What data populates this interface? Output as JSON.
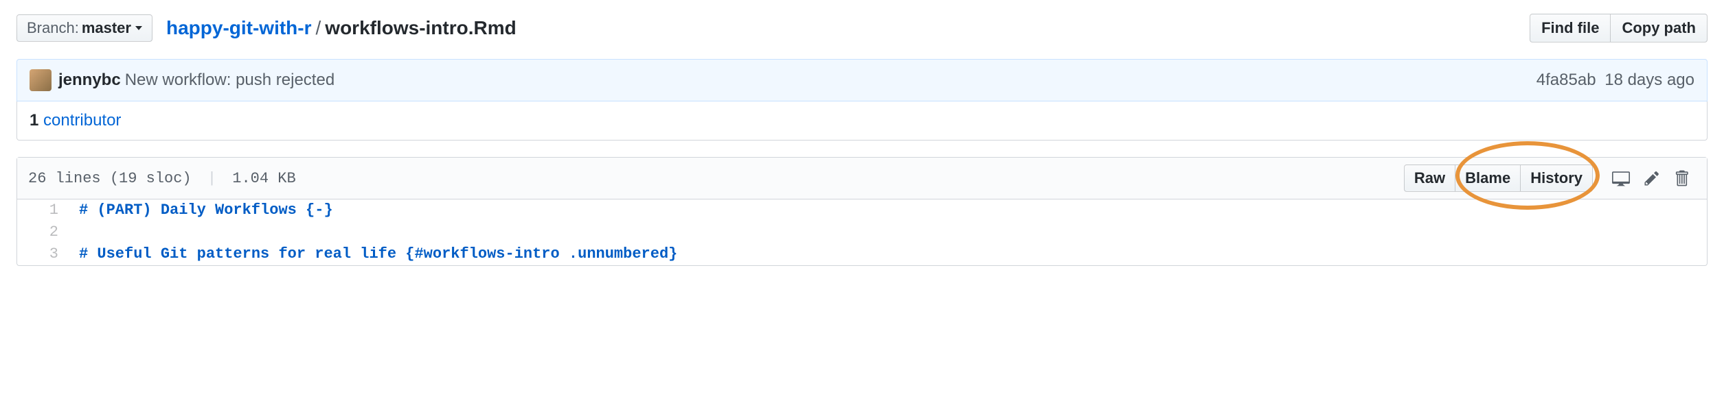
{
  "branch": {
    "label": "Branch:",
    "name": "master"
  },
  "breadcrumb": {
    "repo": "happy-git-with-r",
    "file": "workflows-intro.Rmd"
  },
  "buttons": {
    "find_file": "Find file",
    "copy_path": "Copy path"
  },
  "commit": {
    "author": "jennybc",
    "message": "New workflow: push rejected",
    "sha": "4fa85ab",
    "when": "18 days ago"
  },
  "contrib": {
    "count": "1",
    "label": "contributor"
  },
  "file_header": {
    "lines": "26 lines (19 sloc)",
    "size": "1.04 KB",
    "raw": "Raw",
    "blame": "Blame",
    "history": "History"
  },
  "code": {
    "l1": "# (PART) Daily Workflows {-}",
    "l2": "",
    "l3": "# Useful Git patterns for real life {#workflows-intro .unnumbered}"
  }
}
